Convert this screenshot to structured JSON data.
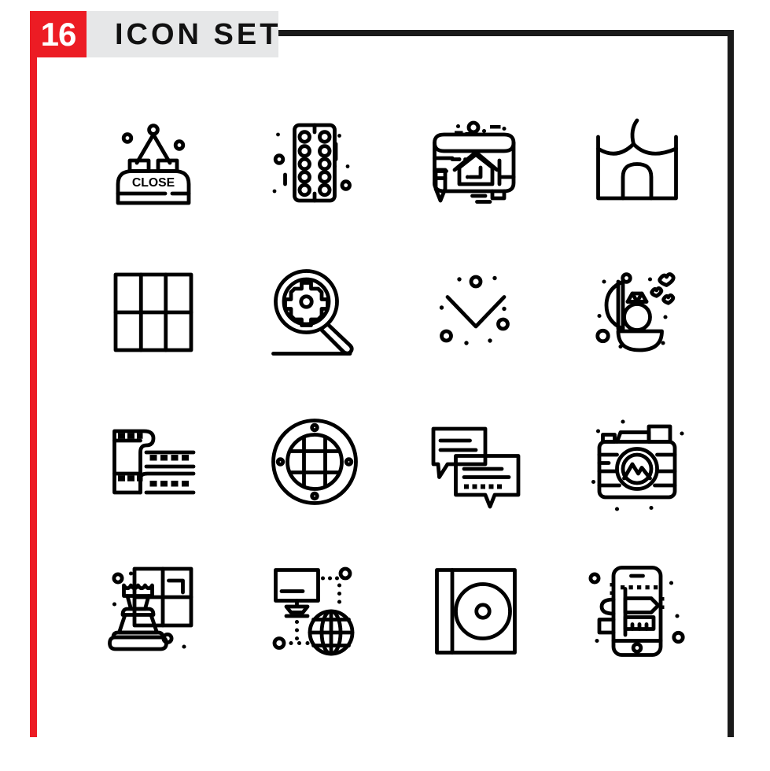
{
  "header": {
    "count_badge": "16",
    "title": "ICON SET",
    "badge_color": "#ec1c24",
    "band_color": "#e6e7e8",
    "frame_color": "#1a1a1a"
  },
  "grid": {
    "columns": 4,
    "rows": 4,
    "total_icons": 16,
    "icons": [
      {
        "index": 1,
        "name": "close-sign-icon",
        "label": "Close hanging sign",
        "sign_text": "CLOSE"
      },
      {
        "index": 2,
        "name": "pill-blister-pack-icon",
        "label": "Pill blister pack"
      },
      {
        "index": 3,
        "name": "blueprint-icon",
        "label": "House blueprint with pencil"
      },
      {
        "index": 4,
        "name": "tent-pavilion-icon",
        "label": "Tent pavilion"
      },
      {
        "index": 5,
        "name": "grid-layout-icon",
        "label": "Grid layout"
      },
      {
        "index": 6,
        "name": "search-settings-icon",
        "label": "Magnifier with gear"
      },
      {
        "index": 7,
        "name": "chevron-down-icon",
        "label": "Chevron down arrow"
      },
      {
        "index": 8,
        "name": "engagement-ring-icon",
        "label": "Diamond ring in box with hearts"
      },
      {
        "index": 9,
        "name": "film-strip-icon",
        "label": "Film strip"
      },
      {
        "index": 10,
        "name": "porthole-grille-icon",
        "label": "Porthole grille"
      },
      {
        "index": 11,
        "name": "chat-bubbles-icon",
        "label": "Chat bubbles"
      },
      {
        "index": 12,
        "name": "camera-landscape-icon",
        "label": "Camera with mountain lens"
      },
      {
        "index": 13,
        "name": "chess-rook-icon",
        "label": "Chess rook on board"
      },
      {
        "index": 14,
        "name": "network-globe-icon",
        "label": "Monitor connected to globe"
      },
      {
        "index": 15,
        "name": "cd-case-icon",
        "label": "CD disc case"
      },
      {
        "index": 16,
        "name": "mobile-signpost-icon",
        "label": "Mobile phone with signpost"
      }
    ]
  }
}
